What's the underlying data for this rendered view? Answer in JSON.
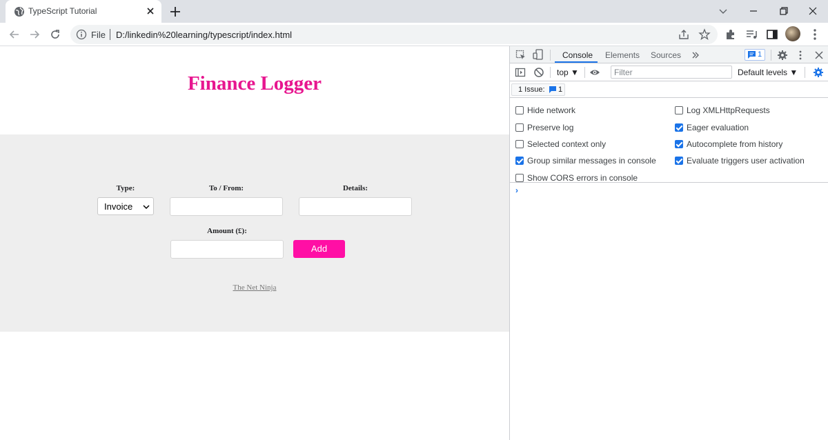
{
  "browser": {
    "tab_title": "TypeScript Tutorial",
    "omnibox_scheme": "File",
    "url": "D:/linkedin%20learning/typescript/index.html"
  },
  "page": {
    "title": "Finance Logger",
    "form": {
      "type_label": "Type:",
      "type_value": "Invoice",
      "tofrom_label": "To / From:",
      "details_label": "Details:",
      "amount_label": "Amount (£):",
      "add_label": "Add"
    },
    "footer_link": "The Net Ninja",
    "colors": {
      "title": "#e7168f",
      "button": "#ff0fa5",
      "section_bg": "#eeeeee"
    }
  },
  "devtools": {
    "tabs": [
      "Console",
      "Elements",
      "Sources"
    ],
    "active_tab": "Console",
    "message_count": "1",
    "context": "top",
    "filter_placeholder": "Filter",
    "levels": "Default levels",
    "issues_label": "1 Issue:",
    "issues_count": "1",
    "settings_left": [
      {
        "label": "Hide network",
        "checked": false
      },
      {
        "label": "Preserve log",
        "checked": false
      },
      {
        "label": "Selected context only",
        "checked": false
      },
      {
        "label": "Group similar messages in console",
        "checked": true
      },
      {
        "label": "Show CORS errors in console",
        "checked": false
      }
    ],
    "settings_right": [
      {
        "label": "Log XMLHttpRequests",
        "checked": false
      },
      {
        "label": "Eager evaluation",
        "checked": true
      },
      {
        "label": "Autocomplete from history",
        "checked": true
      },
      {
        "label": "Evaluate triggers user activation",
        "checked": true
      }
    ],
    "prompt_symbol": "›",
    "accent": "#1a73e8"
  }
}
